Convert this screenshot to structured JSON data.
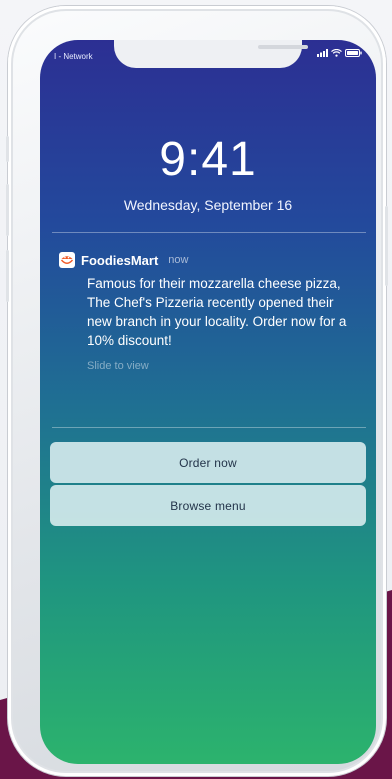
{
  "status_bar": {
    "carrier": "I - Network"
  },
  "lock_screen": {
    "time": "9:41",
    "date": "Wednesday, September 16"
  },
  "notification": {
    "app_name": "FoodiesMart",
    "time": "now",
    "message": "Famous for their mozzarella cheese pizza, The Chef's Pizzeria recently opened their new branch in your locality. Order now for a 10% discount!",
    "hint": "Slide to view"
  },
  "actions": {
    "primary": "Order now",
    "secondary": "Browse menu"
  },
  "icons": {
    "app": "foodiesmart-logo-icon",
    "signal": "signal-icon",
    "wifi": "wifi-icon",
    "battery": "battery-icon"
  },
  "colors": {
    "background_accent": "#6a1548",
    "gradient_top": "#2c2f93",
    "gradient_bottom": "#2cb36d"
  }
}
